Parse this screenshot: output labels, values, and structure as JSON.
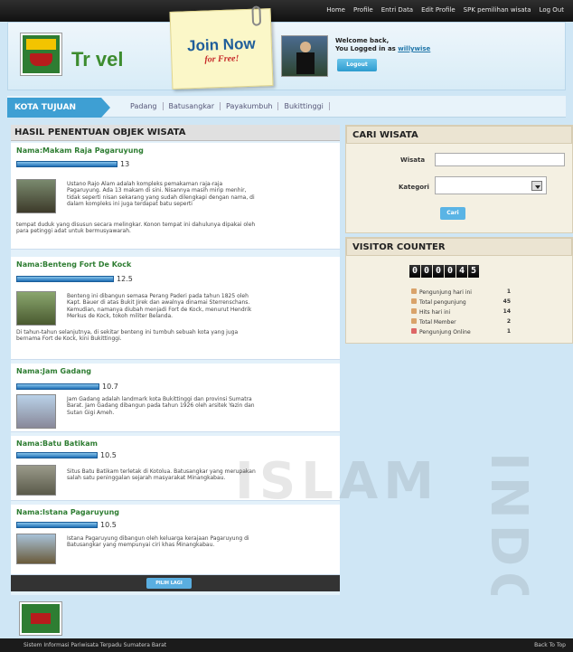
{
  "topnav": {
    "links": [
      "Home",
      "Profile",
      "Entri Data",
      "Edit Profile",
      "SPK pemilihan wisata",
      "Log Out"
    ]
  },
  "header": {
    "logo_text": "Tr vel",
    "join_title": "Join Now",
    "join_sub": "for Free!",
    "welcome_line": "Welcome back,",
    "logged_prefix": "You Logged in as",
    "username": "willywise",
    "logout_label": "Logout"
  },
  "catbar": {
    "kota_label": "KOTA TUJUAN",
    "cities": [
      "Padang",
      "Batusangkar",
      "Payakumbuh",
      "Bukittinggi"
    ]
  },
  "results": {
    "heading": "HASIL PENENTUAN OBJEK WISATA",
    "items": [
      {
        "name": "Nama:Makam Raja Pagaruyung",
        "score": "13",
        "score_value": 13,
        "desc": "Ustano Rajo Alam adalah kompleks pemakaman raja-raja Pagaruyung. Ada 13 makam di sini. Nisannya masih mirip menhir, tidak seperti nisan sekarang yang sudah dilengkapi dengan nama, di dalam kompleks ini juga terdapat batu seperti",
        "more": "tempat duduk yang disusun secara melingkar. Konon tempat ini dahulunya dipakai oleh para petinggi adat untuk bermusyawarah."
      },
      {
        "name": "Nama:Benteng Fort De Kock",
        "score": "12.5",
        "score_value": 12.5,
        "desc": "Benteng ini dibangun semasa Perang Paderi pada tahun 1825 oleh Kapt. Bauer di atas Bukit Jirek dan awalnya dinamai Sterrenschans. Kemudian, namanya diubah menjadi Fort de Kock, menurut Hendrik Merkus de Kock, tokoh militer Belanda.",
        "more": "Di tahun-tahun selanjutnya, di sekitar benteng ini tumbuh sebuah kota yang juga bernama Fort de Kock, kini Bukittinggi."
      },
      {
        "name": "Nama:Jam Gadang",
        "score": "10.7",
        "score_value": 10.7,
        "desc": "Jam Gadang adalah landmark kota Bukittinggi dan provinsi Sumatra Barat. Jam Gadang dibangun pada tahun 1926 oleh arsitek Yazin dan Sutan Gigi Ameh.",
        "more": ""
      },
      {
        "name": "Nama:Batu Batikam",
        "score": "10.5",
        "score_value": 10.5,
        "desc": "Situs Batu Batikam terletak di Kotolua. Batusangkar yang merupakan salah satu peninggalan sejarah masyarakat Minangkabau.",
        "more": ""
      },
      {
        "name": "Nama:Istana Pagaruyung",
        "score": "10.5",
        "score_value": 10.5,
        "desc": "Istana Pagaruyung dibangun oleh keluarga kerajaan Pagaruyung di Batusangkar yang mempunyai ciri khas Minangkabau.",
        "more": ""
      }
    ],
    "pilih_label": "PILIH LAGI"
  },
  "cari": {
    "heading": "CARI WISATA",
    "wisata_label": "Wisata",
    "kategori_label": "Kategori",
    "button": "Cari"
  },
  "visitor": {
    "heading": "VISITOR COUNTER",
    "digits": [
      "0",
      "0",
      "0",
      "0",
      "4",
      "5"
    ],
    "rows": [
      {
        "label": "Pengunjung hari ini",
        "value": "1"
      },
      {
        "label": "Total pengunjung",
        "value": "45"
      },
      {
        "label": "Hits hari ini",
        "value": "14"
      },
      {
        "label": "Total Member",
        "value": "2"
      },
      {
        "label": "Pengunjung Online",
        "value": "1"
      }
    ]
  },
  "watermark": {
    "text1": "ISLAM",
    "text2": "INDO"
  },
  "footer": {
    "left_text": "Sistem Informasi Pariwisata Terpadu Sumatera Barat",
    "right_text": "Back To Top"
  }
}
